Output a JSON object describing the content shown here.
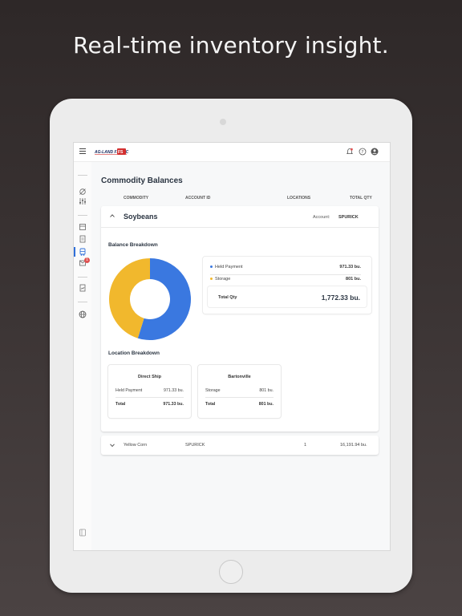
{
  "headline": "Real-time inventory insight.",
  "app": {
    "title": "Commodity Balances",
    "columns": [
      "COMMODITY",
      "ACCOUNT ID",
      "LOCATIONS",
      "TOTAL QTY"
    ],
    "sidebar_icons": [
      "fork-icon",
      "sliders-icon",
      "archive-icon",
      "document-icon",
      "truck-icon",
      "inbox-icon",
      "report-icon",
      "globe-icon",
      "collapse-icon"
    ],
    "topbar_icons": [
      "menu-icon",
      "bell-icon",
      "help-icon",
      "account-icon"
    ]
  },
  "commodities": [
    {
      "name": "Soybeans",
      "expanded": true,
      "account_label": "Account:",
      "account": "SPURICK",
      "balance_title": "Balance Breakdown",
      "balance": [
        {
          "label": "Held Payment",
          "value": "971.33 bu.",
          "color": "#3a78e0"
        },
        {
          "label": "Storage",
          "value": "801 bu.",
          "color": "#f1b82d"
        }
      ],
      "total_label": "Total Qty",
      "total_value": "1,772.33 bu.",
      "location_title": "Location Breakdown",
      "locations": [
        {
          "name": "Direct Ship",
          "row_label": "Held Payment",
          "row_value": "971.33 bu.",
          "total_label": "Total",
          "total_value": "971.33 bu."
        },
        {
          "name": "Bartonville",
          "row_label": "Storage",
          "row_value": "801 bu.",
          "total_label": "Total",
          "total_value": "801 bu."
        }
      ]
    },
    {
      "name": "Yellow Corn",
      "expanded": false,
      "account": "SPURICK",
      "locations_count": "1",
      "total_qty": "16,191.94 bu."
    }
  ],
  "chart_data": {
    "type": "pie",
    "categories": [
      "Held Payment",
      "Storage"
    ],
    "values": [
      971.33,
      801
    ],
    "colors": [
      "#3a78e0",
      "#f1b82d"
    ],
    "donut": true
  },
  "inbox_badge": "1"
}
